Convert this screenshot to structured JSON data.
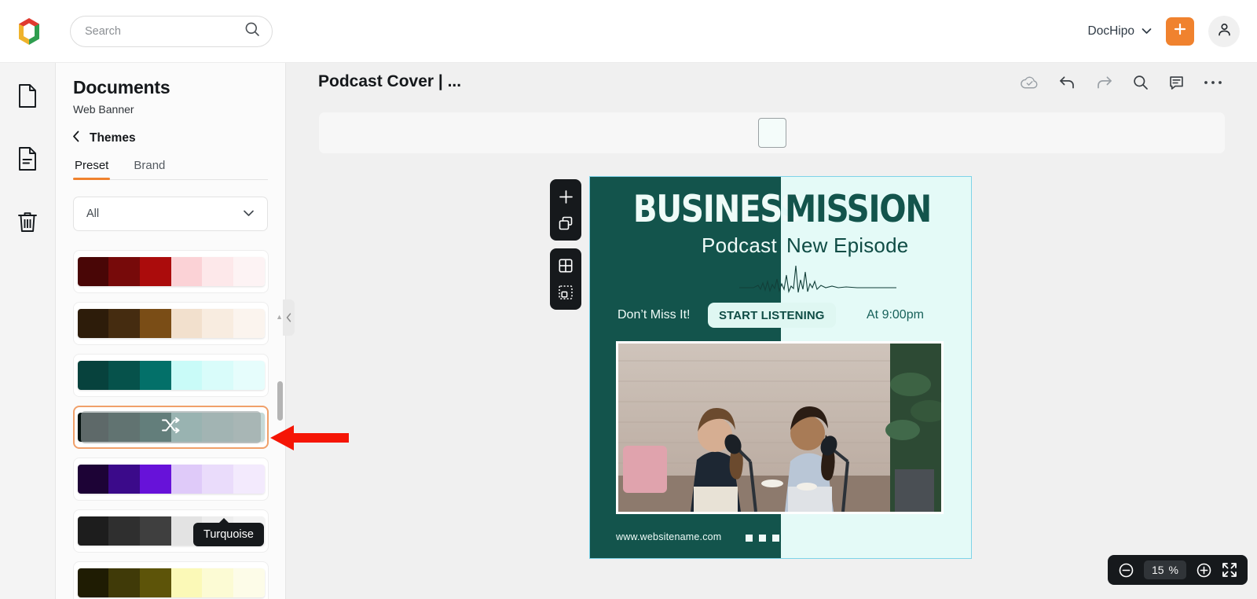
{
  "topbar": {
    "logo_icon": "dochipo-logo",
    "search": {
      "placeholder": "Search",
      "value": "",
      "icon": "search-icon"
    },
    "account_name": "DocHipo",
    "account_caret_icon": "chevron-down-icon",
    "create_icon": "plus-icon",
    "avatar_icon": "user-avatar-icon"
  },
  "rail": {
    "items": [
      {
        "name": "blank-page",
        "icon": "page-icon",
        "active": false
      },
      {
        "name": "documents",
        "icon": "document-lines-icon",
        "active": true
      },
      {
        "name": "trash",
        "icon": "trash-icon",
        "active": false
      }
    ]
  },
  "panel": {
    "title": "Documents",
    "subtitle": "Web Banner",
    "back_icon": "chevron-left-icon",
    "back_label": "Themes",
    "tabs": [
      {
        "label": "Preset",
        "active": true
      },
      {
        "label": "Brand",
        "active": false
      }
    ],
    "filter": {
      "value": "All",
      "icon": "chevron-down-icon"
    },
    "tooltip": "Turquoise",
    "shuffle_icon": "shuffle-icon",
    "collapse_icon": "chevron-left-icon",
    "palettes": [
      {
        "name": "Maroon",
        "colors": [
          "#490606",
          "#770a0a",
          "#ab0c0c",
          "#fbd2d6",
          "#fde8ea",
          "#fdf3f4"
        ]
      },
      {
        "name": "Brown",
        "colors": [
          "#2d1c0a",
          "#452c10",
          "#7a4d16",
          "#f2e0cd",
          "#f8ece0",
          "#fbf4ee"
        ]
      },
      {
        "name": "Teal",
        "colors": [
          "#07423d",
          "#06524b",
          "#037069",
          "#c9fbf8",
          "#d9fcfa",
          "#e6fdfc"
        ]
      },
      {
        "name": "Turquoise",
        "colors": [
          "#041210",
          "#0d2b27",
          "#114740",
          "#9fd1cd",
          "#b5d6d3",
          "#c5d9d7"
        ],
        "selected": true
      },
      {
        "name": "Purple",
        "colors": [
          "#1d0336",
          "#3b0a8a",
          "#6712d9",
          "#dfcaf9",
          "#eadcfb",
          "#f3eafd"
        ]
      },
      {
        "name": "Gray",
        "colors": [
          "#1d1d1d",
          "#2f2f2f",
          "#3f3f3f",
          "#e3e3e3",
          "#ededed",
          "#f3f3f3"
        ]
      },
      {
        "name": "Olive",
        "colors": [
          "#1f1c03",
          "#403a08",
          "#5d5409",
          "#fbf9b7",
          "#fcfbd4",
          "#fdfce8"
        ]
      }
    ]
  },
  "editor": {
    "doc_title": "Podcast Cover | ...",
    "tools": [
      {
        "name": "cloud-saved-icon",
        "label": "Saved"
      },
      {
        "name": "undo-icon",
        "label": "Undo"
      },
      {
        "name": "redo-icon",
        "label": "Redo"
      },
      {
        "name": "search-icon",
        "label": "Find"
      },
      {
        "name": "comment-icon",
        "label": "Comments"
      },
      {
        "name": "more-icon",
        "label": "More"
      }
    ],
    "canvas_tools": [
      {
        "name": "add-page-icon"
      },
      {
        "name": "duplicate-page-icon"
      },
      {
        "name": "grid-layout-icon"
      },
      {
        "name": "select-frame-icon"
      }
    ],
    "zoom": {
      "out_icon": "zoom-out-icon",
      "value": "15",
      "unit": "%",
      "in_icon": "zoom-in-icon",
      "fullscreen_icon": "fullscreen-icon"
    }
  },
  "design": {
    "title_left": "BUSINESS",
    "title_right": "MISSION",
    "subtitle_left": "Podcast",
    "subtitle_right": "New Episode",
    "cta_prefix": "Don’t Miss It!",
    "cta_button": "START LISTENING",
    "cta_time": "At 9:00pm",
    "website": "www.websitename.com",
    "colors": {
      "dark_teal": "#13544c",
      "light_mint": "#e4faf7",
      "pill_bg": "#dff7f2",
      "accent": "#f0822e"
    }
  }
}
